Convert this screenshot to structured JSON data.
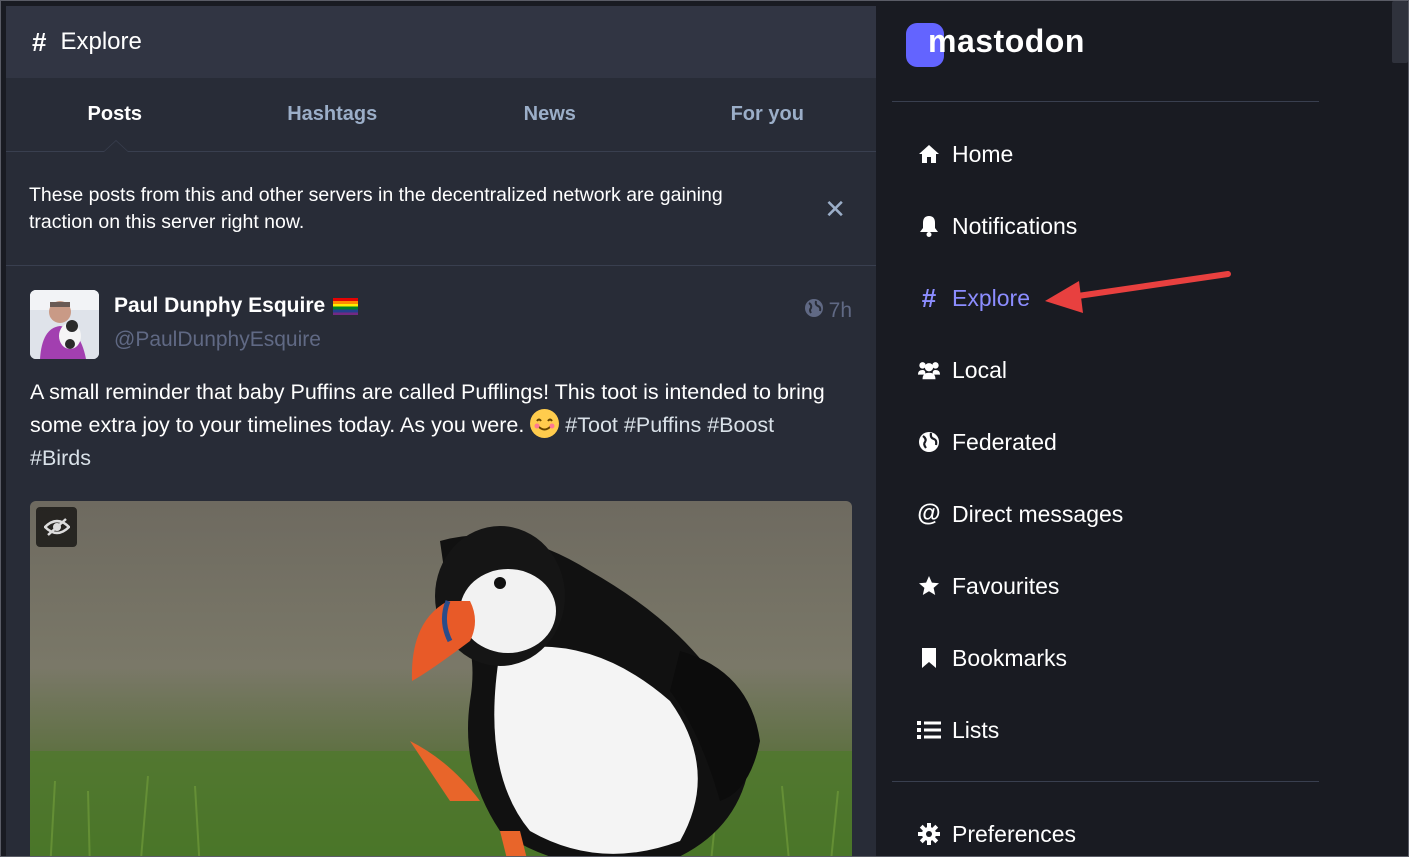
{
  "column": {
    "title": "Explore",
    "tabs": [
      {
        "label": "Posts",
        "active": true
      },
      {
        "label": "Hashtags",
        "active": false
      },
      {
        "label": "News",
        "active": false
      },
      {
        "label": "For you",
        "active": false
      }
    ],
    "banner_text": "These posts from this and other servers in the decentralized network are gaining traction on this server right now."
  },
  "post": {
    "display_name": "Paul Dunphy Esquire",
    "account": "@PaulDunphyEsquire",
    "time": "7h",
    "visibility_icon": "globe-icon",
    "text_main": "A small reminder that baby Puffins are called Pufflings! This toot is intended to bring some extra joy to your timelines today. As you were.",
    "hashtags": [
      "#Toot",
      "#Puffins",
      "#Boost",
      "#Birds"
    ]
  },
  "nav": {
    "logo_text": "mastodon",
    "items": [
      {
        "label": "Home",
        "icon": "home-icon",
        "active": false
      },
      {
        "label": "Notifications",
        "icon": "bell-icon",
        "active": false
      },
      {
        "label": "Explore",
        "icon": "hashtag-icon",
        "active": true
      },
      {
        "label": "Local",
        "icon": "users-icon",
        "active": false
      },
      {
        "label": "Federated",
        "icon": "globe-icon",
        "active": false
      },
      {
        "label": "Direct messages",
        "icon": "at-icon",
        "active": false
      },
      {
        "label": "Favourites",
        "icon": "star-icon",
        "active": false
      },
      {
        "label": "Bookmarks",
        "icon": "bookmark-icon",
        "active": false
      },
      {
        "label": "Lists",
        "icon": "list-icon",
        "active": false
      }
    ],
    "preferences_label": "Preferences"
  },
  "colors": {
    "accent": "#8c8dff",
    "annotation_arrow": "#e8403f",
    "background": "#191b22",
    "column": "#282c37"
  }
}
